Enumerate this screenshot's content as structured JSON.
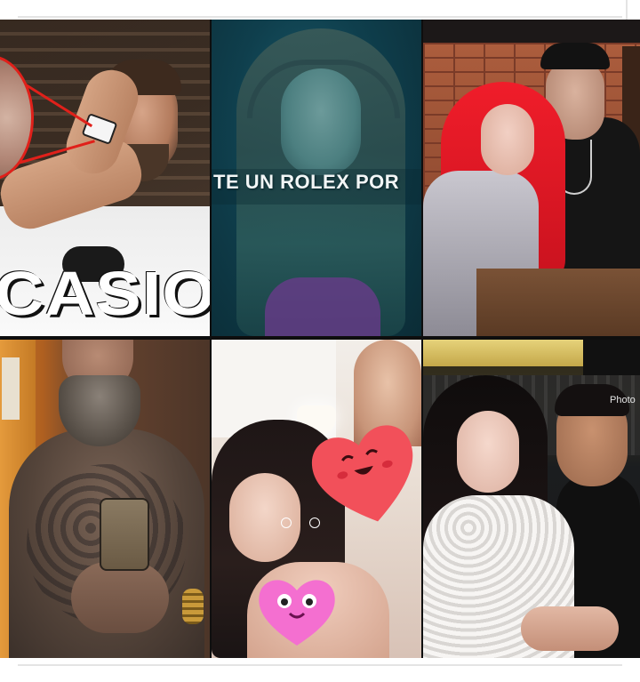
{
  "collage": {
    "tile_1_caption": "CASIO",
    "tile_2_caption": "TE UN ROLEX POR",
    "tile_6_watermark": "Photo"
  },
  "colors": {
    "red_highlight": "#e0201a",
    "teal_bg": "#0f3f4d",
    "heart_red": "#f2505a",
    "heart_pink": "#f46fd0"
  }
}
